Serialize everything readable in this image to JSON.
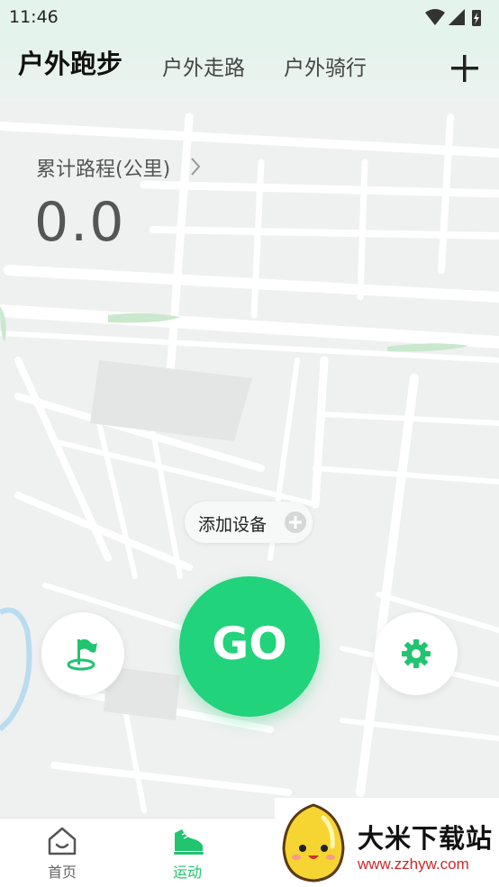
{
  "status_bar": {
    "time": "11:46"
  },
  "header": {
    "tabs": [
      {
        "label": "户外跑步",
        "active": true
      },
      {
        "label": "户外走路",
        "active": false
      },
      {
        "label": "户外骑行",
        "active": false
      }
    ]
  },
  "stats": {
    "distance_label": "累计路程(公里)",
    "distance_value": "0.0"
  },
  "device": {
    "label": "添加设备"
  },
  "controls": {
    "go_label": "GO"
  },
  "bottom_nav": {
    "items": [
      {
        "label": "首页",
        "active": false
      },
      {
        "label": "运动",
        "active": true
      }
    ]
  },
  "watermark": {
    "title": "大米下载站",
    "url": "www.zzhyw.com"
  },
  "colors": {
    "accent": "#21d37a",
    "header_bg": "#e4f3ec",
    "map_bg": "#eff0f0"
  }
}
